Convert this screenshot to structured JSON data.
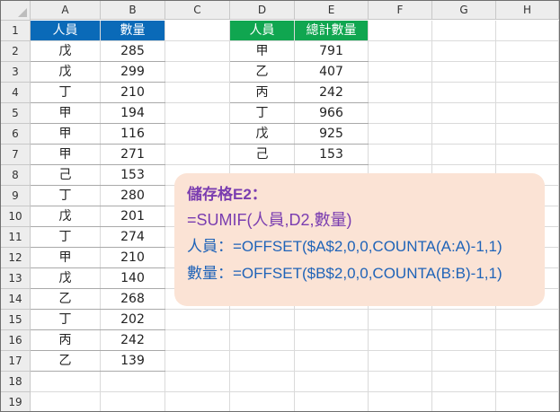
{
  "columns": [
    "A",
    "B",
    "C",
    "D",
    "E",
    "F",
    "G",
    "H"
  ],
  "rows": [
    "1",
    "2",
    "3",
    "4",
    "5",
    "6",
    "7",
    "8",
    "9",
    "10",
    "11",
    "12",
    "13",
    "14",
    "15",
    "16",
    "17",
    "18",
    "19"
  ],
  "table1": {
    "headers": [
      "人員",
      "數量"
    ],
    "rows": [
      [
        "戊",
        "285"
      ],
      [
        "戊",
        "299"
      ],
      [
        "丁",
        "210"
      ],
      [
        "甲",
        "194"
      ],
      [
        "甲",
        "116"
      ],
      [
        "甲",
        "271"
      ],
      [
        "己",
        "153"
      ],
      [
        "丁",
        "280"
      ],
      [
        "戊",
        "201"
      ],
      [
        "丁",
        "274"
      ],
      [
        "甲",
        "210"
      ],
      [
        "戊",
        "140"
      ],
      [
        "乙",
        "268"
      ],
      [
        "丁",
        "202"
      ],
      [
        "丙",
        "242"
      ],
      [
        "乙",
        "139"
      ]
    ]
  },
  "table2": {
    "headers": [
      "人員",
      "總計數量"
    ],
    "rows": [
      [
        "甲",
        "791"
      ],
      [
        "乙",
        "407"
      ],
      [
        "丙",
        "242"
      ],
      [
        "丁",
        "966"
      ],
      [
        "戊",
        "925"
      ],
      [
        "己",
        "153"
      ]
    ]
  },
  "callout": {
    "line1": "儲存格E2：",
    "line2": "=SUMIF(人員,D2,數量)",
    "line3": "人員：=OFFSET($A$2,0,0,COUNTA(A:A)-1,1)",
    "line4": "數量：=OFFSET($B$2,0,0,COUNTA(B:B)-1,1)"
  },
  "colors": {
    "table1_header": "#0a6ab8",
    "table2_header": "#10a650",
    "callout_bg": "#fbe3d5",
    "callout_purple": "#7a3db0",
    "callout_blue": "#1f63b8"
  }
}
